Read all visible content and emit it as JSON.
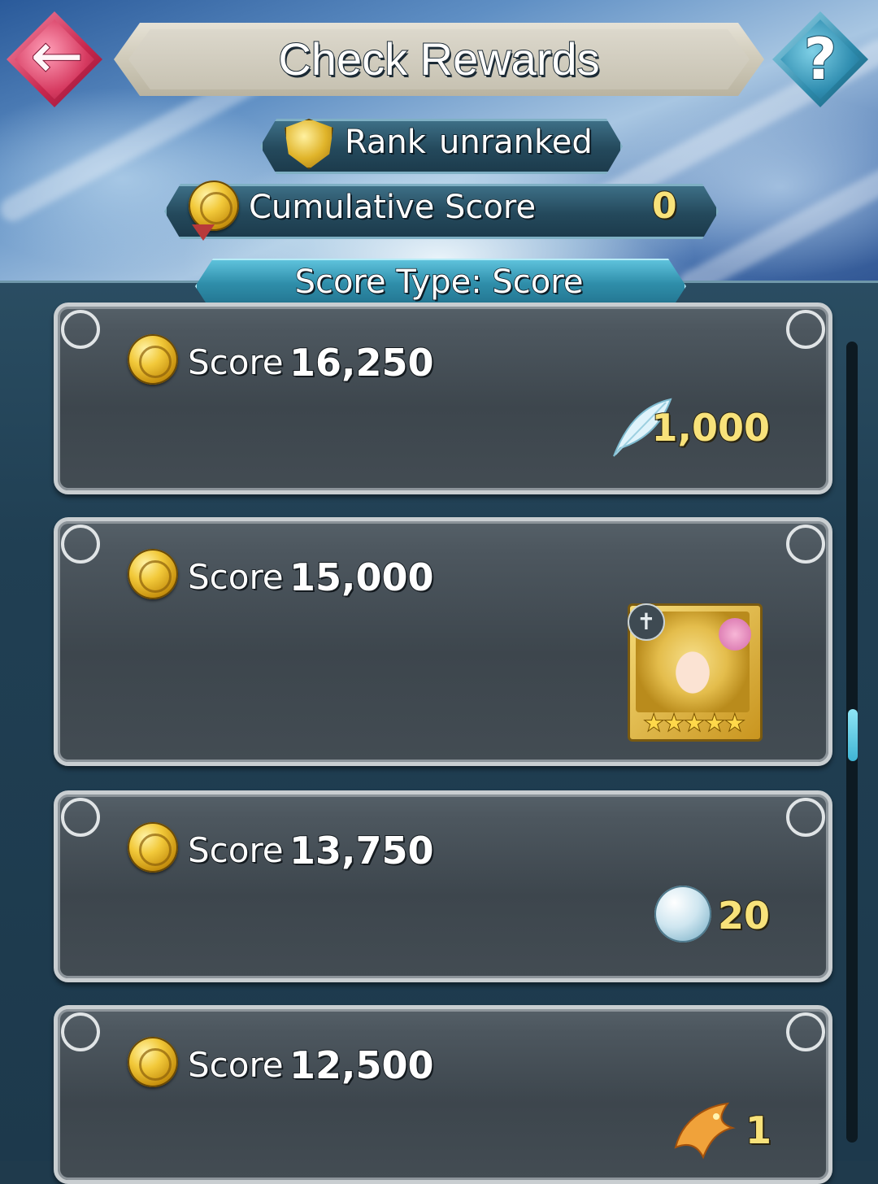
{
  "header": {
    "title": "Check Rewards",
    "back_icon": "back-arrow-icon",
    "help_label": "?"
  },
  "rank": {
    "label": "Rank",
    "value": "unranked"
  },
  "cumulative": {
    "label": "Cumulative Score",
    "value": "0"
  },
  "score_type": {
    "label": "Score Type: Score"
  },
  "rewards": [
    {
      "label": "Score",
      "value": "16,250",
      "reward_icon": "feather-icon",
      "quantity": "1,000"
    },
    {
      "label": "Score",
      "value": "15,000",
      "reward_icon": "hero-portrait-icon",
      "rarity_stars": 5,
      "quantity": ""
    },
    {
      "label": "Score",
      "value": "13,750",
      "reward_icon": "divine-dew-coin-icon",
      "quantity": "20"
    },
    {
      "label": "Score",
      "value": "12,500",
      "reward_icon": "golden-bird-icon",
      "quantity": "1"
    }
  ],
  "colors": {
    "gold_text": "#f8e27a",
    "back_button": "#d63a60",
    "help_button": "#2f8db0",
    "scroll_thumb": "#3fb5d4"
  }
}
